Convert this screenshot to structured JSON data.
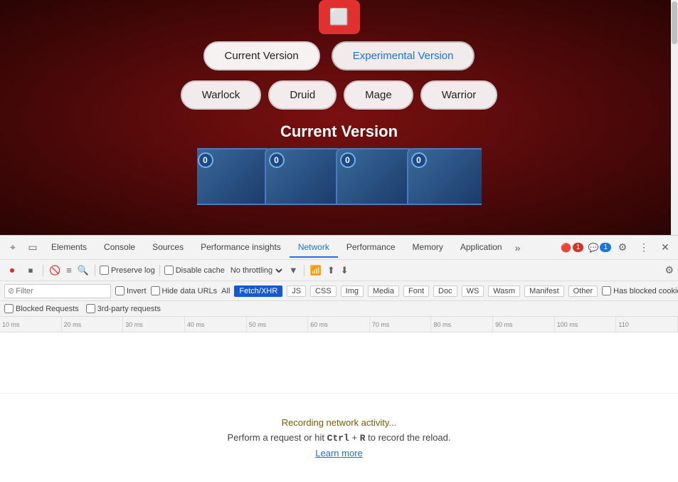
{
  "browser": {
    "logo_symbol": "⬜"
  },
  "main": {
    "version_buttons": [
      {
        "label": "Current Version",
        "id": "current",
        "active": true
      },
      {
        "label": "Experimental Version",
        "id": "experimental",
        "active": false
      }
    ],
    "class_buttons": [
      {
        "label": "Warlock"
      },
      {
        "label": "Druid"
      },
      {
        "label": "Mage"
      },
      {
        "label": "Warrior"
      }
    ],
    "current_version_label": "Current Version",
    "cards": [
      {
        "mana": "0"
      },
      {
        "mana": "0"
      },
      {
        "mana": "0"
      },
      {
        "mana": "0"
      }
    ]
  },
  "devtools": {
    "tabs": [
      {
        "label": "Elements",
        "active": false
      },
      {
        "label": "Console",
        "active": false
      },
      {
        "label": "Sources",
        "active": false
      },
      {
        "label": "Performance insights",
        "active": false
      },
      {
        "label": "Network",
        "active": true
      },
      {
        "label": "Performance",
        "active": false
      },
      {
        "label": "Memory",
        "active": false
      },
      {
        "label": "Application",
        "active": false
      }
    ],
    "more_tabs_label": "»",
    "error_badge": "1",
    "warning_badge": "1",
    "network_toolbar": {
      "preserve_log_label": "Preserve log",
      "disable_cache_label": "Disable cache",
      "throttle_label": "No throttling"
    },
    "filter_bar": {
      "placeholder": "Filter",
      "invert_label": "Invert",
      "hide_data_urls_label": "Hide data URLs",
      "all_label": "All",
      "filter_types": [
        "Fetch/XHR",
        "JS",
        "CSS",
        "Img",
        "Media",
        "Font",
        "Doc",
        "WS",
        "Wasm",
        "Manifest",
        "Other"
      ],
      "has_blocked_cookies_label": "Has blocked cookies",
      "blocked_requests_label": "Blocked Requests",
      "third_party_label": "3rd-party requests"
    },
    "timeline": {
      "ticks": [
        "10 ms",
        "20 ms",
        "30 ms",
        "40 ms",
        "50 ms",
        "60 ms",
        "70 ms",
        "80 ms",
        "90 ms",
        "100 ms",
        "110"
      ]
    },
    "empty_state": {
      "recording_text": "Recording network activity...",
      "perform_text_before": "Perform a request or hit ",
      "ctrl_r": "Ctrl",
      "plus": " + ",
      "r_key": "R",
      "perform_text_after": " to record the reload.",
      "learn_more": "Learn more"
    }
  }
}
